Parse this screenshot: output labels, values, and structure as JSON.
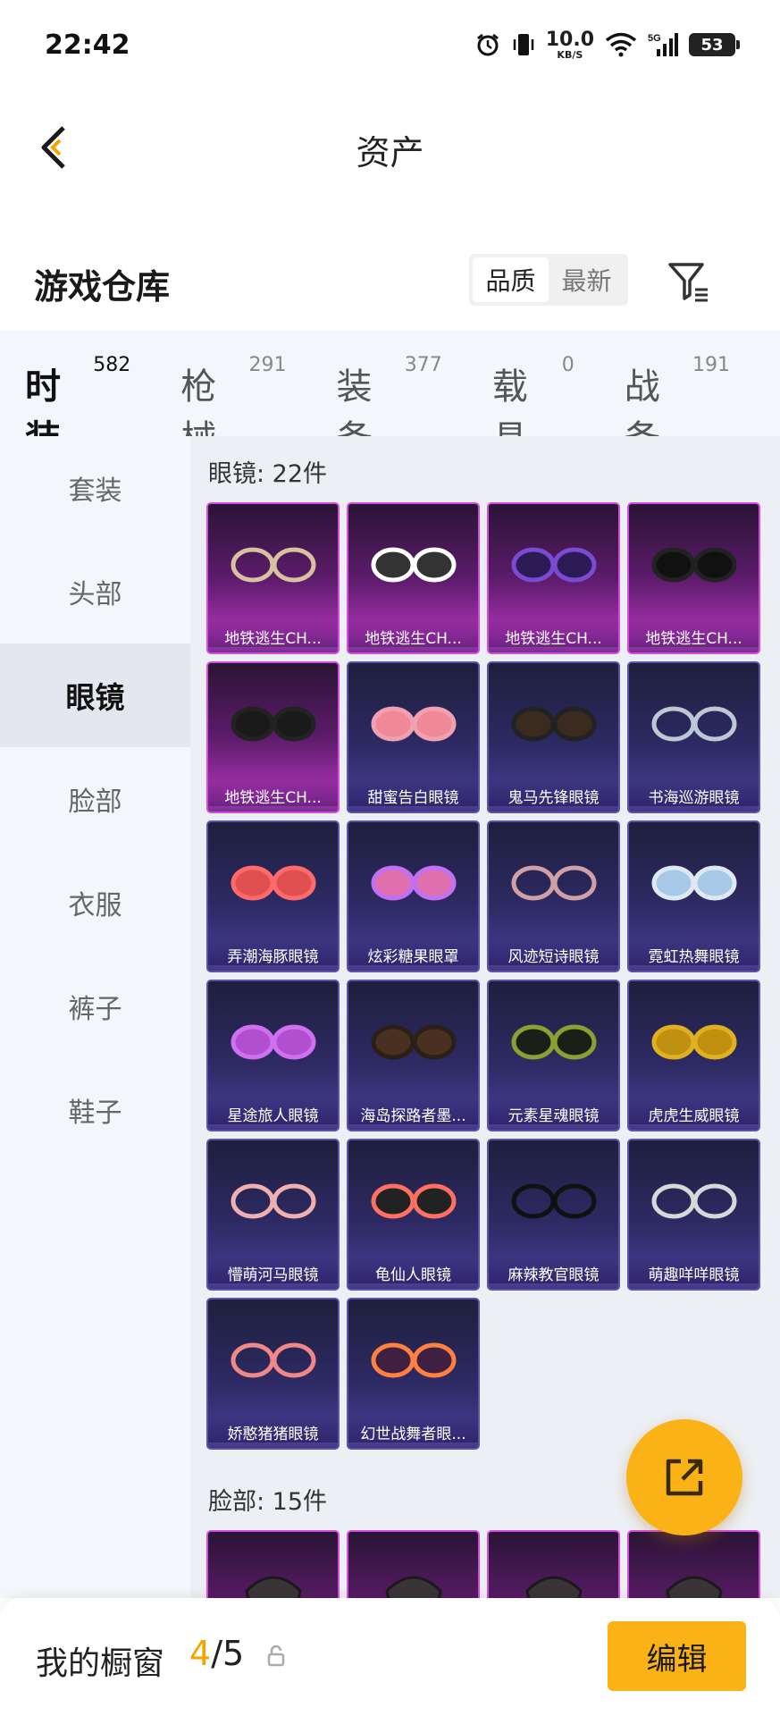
{
  "status_bar": {
    "time": "22:42",
    "net_speed": "10.0",
    "net_unit": "KB/S",
    "network": "5G",
    "battery": "53"
  },
  "nav": {
    "title": "资产"
  },
  "header": {
    "title": "游戏仓库",
    "sort_options": [
      "品质",
      "最新"
    ],
    "sort_active": "品质"
  },
  "tabs": [
    {
      "label": "时装",
      "count": "582",
      "active": true
    },
    {
      "label": "枪械",
      "count": "291",
      "active": false
    },
    {
      "label": "装备",
      "count": "377",
      "active": false
    },
    {
      "label": "载具",
      "count": "0",
      "active": false
    },
    {
      "label": "战备",
      "count": "191",
      "active": false
    }
  ],
  "sidebar": {
    "items": [
      {
        "label": "套装",
        "active": false
      },
      {
        "label": "头部",
        "active": false
      },
      {
        "label": "眼镜",
        "active": true
      },
      {
        "label": "脸部",
        "active": false
      },
      {
        "label": "衣服",
        "active": false
      },
      {
        "label": "裤子",
        "active": false
      },
      {
        "label": "鞋子",
        "active": false
      }
    ]
  },
  "groups": [
    {
      "label": "眼镜: 22件",
      "items": [
        {
          "name": "地铁逃生CH...",
          "rarity": "legendary",
          "icon": "thin-wire-glasses-icon"
        },
        {
          "name": "地铁逃生CH...",
          "rarity": "legendary",
          "icon": "white-goggles-icon"
        },
        {
          "name": "地铁逃生CH...",
          "rarity": "legendary",
          "icon": "visor-icon"
        },
        {
          "name": "地铁逃生CH...",
          "rarity": "legendary",
          "icon": "shutter-shades-icon"
        },
        {
          "name": "地铁逃生CH...",
          "rarity": "legendary",
          "icon": "tech-glasses-icon"
        },
        {
          "name": "甜蜜告白眼镜",
          "rarity": "epic",
          "icon": "pink-round-glasses-icon"
        },
        {
          "name": "鬼马先锋眼镜",
          "rarity": "epic",
          "icon": "dark-sunglasses-icon"
        },
        {
          "name": "书海巡游眼镜",
          "rarity": "epic",
          "icon": "round-reading-glasses-icon"
        },
        {
          "name": "弄潮海豚眼镜",
          "rarity": "epic",
          "icon": "red-round-sunglasses-icon"
        },
        {
          "name": "炫彩糖果眼罩",
          "rarity": "epic",
          "icon": "candy-eye-mask-icon"
        },
        {
          "name": "风迹短诗眼镜",
          "rarity": "epic",
          "icon": "pink-tint-glasses-icon"
        },
        {
          "name": "霓虹热舞眼镜",
          "rarity": "epic",
          "icon": "ice-goggles-icon"
        },
        {
          "name": "星途旅人眼镜",
          "rarity": "epic",
          "icon": "purple-visor-icon"
        },
        {
          "name": "海岛探路者墨...",
          "rarity": "epic",
          "icon": "brown-sunglasses-icon"
        },
        {
          "name": "元素星魂眼镜",
          "rarity": "epic",
          "icon": "green-frame-sunglasses-icon"
        },
        {
          "name": "虎虎生威眼镜",
          "rarity": "epic",
          "icon": "gold-goggles-icon"
        },
        {
          "name": "懵萌河马眼镜",
          "rarity": "epic",
          "icon": "heart-glasses-icon"
        },
        {
          "name": "龟仙人眼镜",
          "rarity": "epic",
          "icon": "red-frame-sunglasses-icon"
        },
        {
          "name": "麻辣教官眼镜",
          "rarity": "epic",
          "icon": "rect-black-glasses-icon"
        },
        {
          "name": "萌趣咩咩眼镜",
          "rarity": "epic",
          "icon": "double-glasses-icon"
        },
        {
          "name": "娇憨猪猪眼镜",
          "rarity": "epic",
          "icon": "pink-double-glasses-icon"
        },
        {
          "name": "幻世战舞者眼...",
          "rarity": "epic",
          "icon": "iridescent-sunglasses-icon"
        }
      ]
    },
    {
      "label": "脸部: 15件",
      "items": [
        {
          "name": "",
          "rarity": "legendary",
          "icon": "face-mask-icon"
        },
        {
          "name": "",
          "rarity": "legendary",
          "icon": "respirator-icon"
        },
        {
          "name": "",
          "rarity": "legendary",
          "icon": "black-mask-icon"
        },
        {
          "name": "",
          "rarity": "legendary",
          "icon": "gear-mask-icon"
        }
      ]
    }
  ],
  "bottom_bar": {
    "label": "我的橱窗",
    "current": "4",
    "separator": "/",
    "max": "5",
    "edit_label": "编辑"
  },
  "colors": {
    "accent": "#fbb216",
    "tab_indicator": "#f5a500",
    "legendary_border": "#d64be0",
    "epic_border": "#5e52a8"
  }
}
